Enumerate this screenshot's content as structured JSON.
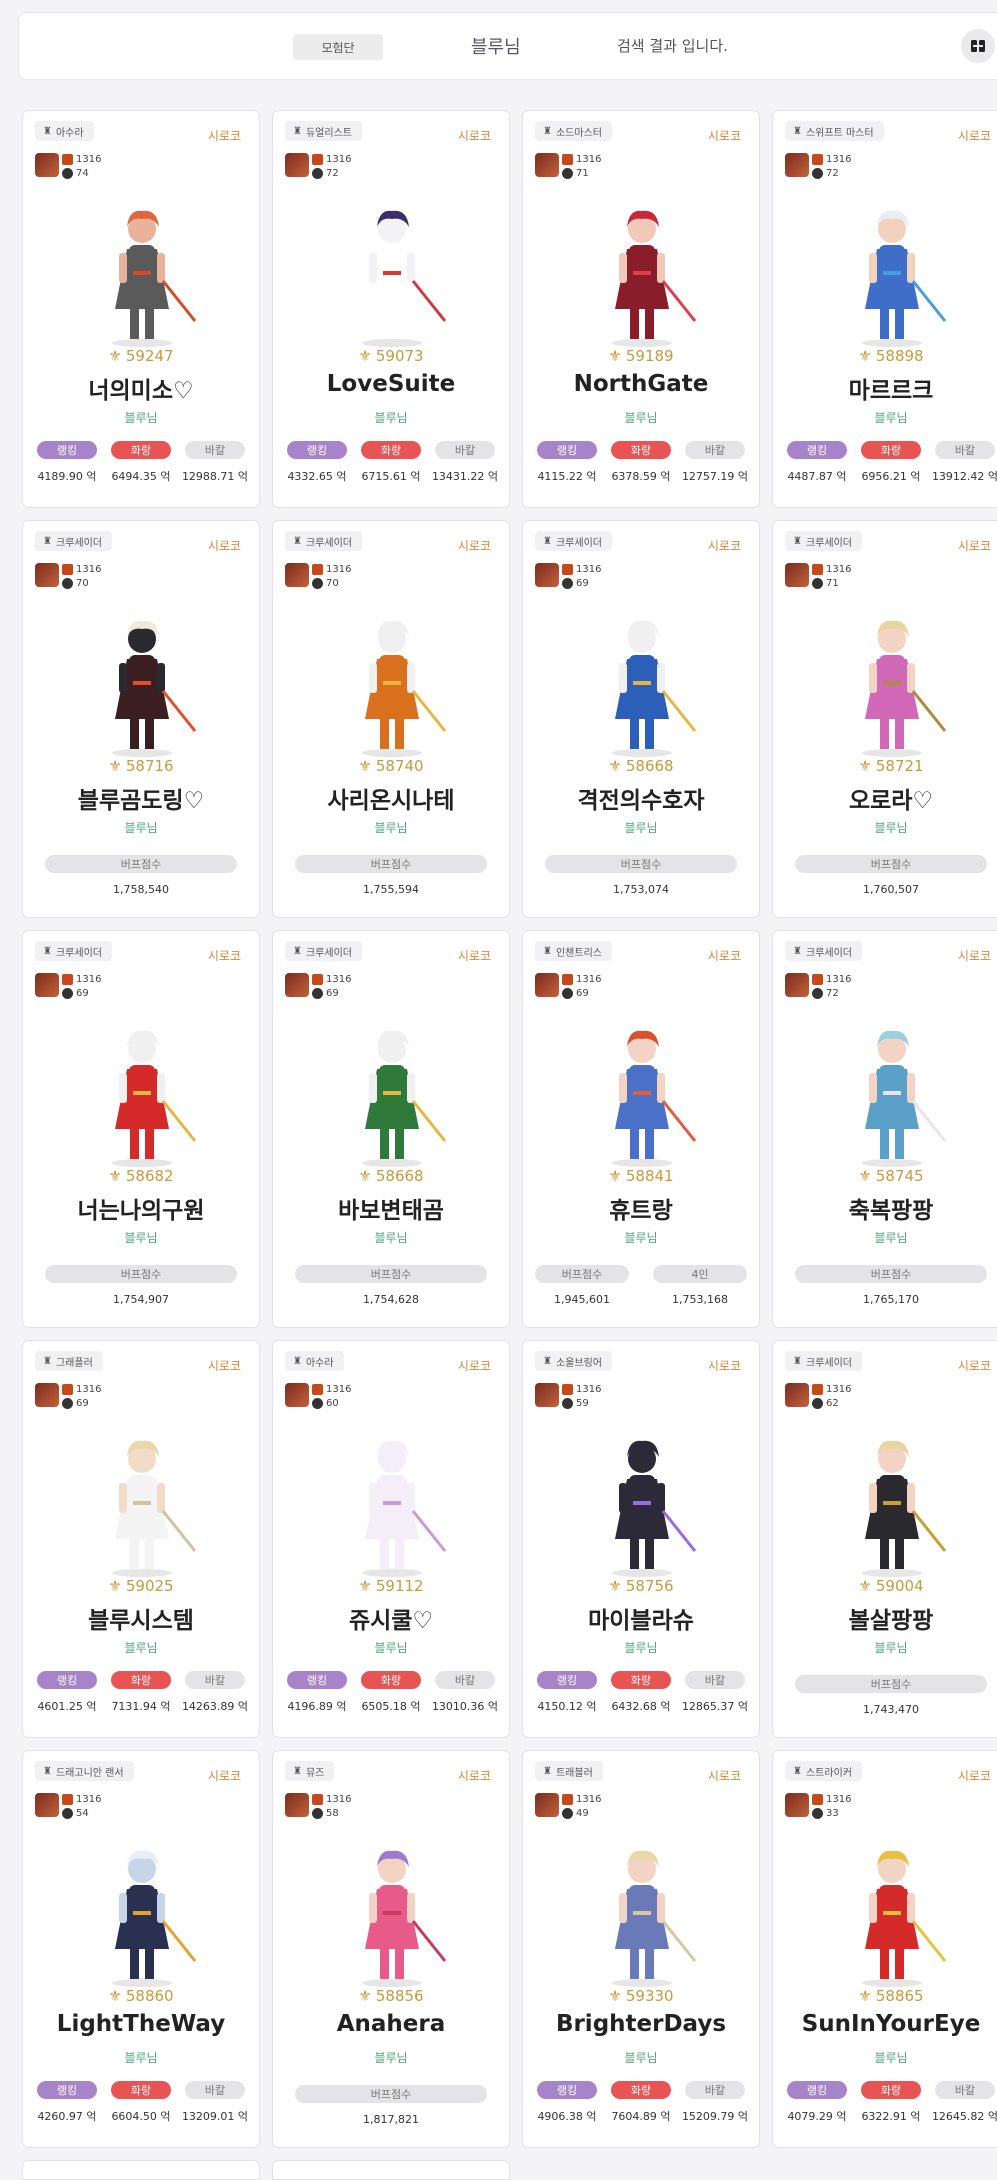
{
  "header": {
    "guild_label": "모험단",
    "adventure_name": "블루님",
    "result_text": "검색 결과 입니다.",
    "toggle_icon": "layout-toggle-icon"
  },
  "cards": [
    {
      "class": "아수라",
      "server": "시로코",
      "level": "1316",
      "level2": "74",
      "fame": "59247",
      "name": "너의미소♡",
      "adventure": "블루님",
      "type": "damage",
      "rank_label": "랭킹",
      "rank": "4189.90 억",
      "fire_label": "화랑",
      "fire": "6494.35 억",
      "bal_label": "바칼",
      "bal": "12988.71 억",
      "art": {
        "skin": "#e8b39a",
        "outfit": "#5a5a5a",
        "accent": "#d64a2a",
        "hair": "#e0673a"
      }
    },
    {
      "class": "듀얼리스트",
      "server": "시로코",
      "level": "1316",
      "level2": "72",
      "fame": "59073",
      "name": "LoveSuite",
      "adventure": "블루님",
      "type": "damage",
      "rank_label": "랭킹",
      "rank": "4332.65 억",
      "fire_label": "화랑",
      "fire": "6715.61 억",
      "bal_label": "바칼",
      "bal": "13431.22 억",
      "art": {
        "skin": "#f3f3f6",
        "outfit": "#ffffff",
        "accent": "#d23a3a",
        "hair": "#3b2f6b"
      }
    },
    {
      "class": "소드마스터",
      "server": "시로코",
      "level": "1316",
      "level2": "71",
      "fame": "59189",
      "name": "NorthGate",
      "adventure": "블루님",
      "type": "damage",
      "rank_label": "랭킹",
      "rank": "4115.22 억",
      "fire_label": "화랑",
      "fire": "6378.59 억",
      "bal_label": "바칼",
      "bal": "12757.19 억",
      "art": {
        "skin": "#f0c9b8",
        "outfit": "#8a1d2a",
        "accent": "#e23d4f",
        "hair": "#c8283a"
      }
    },
    {
      "class": "스위프트 마스터",
      "server": "시로코",
      "level": "1316",
      "level2": "72",
      "fame": "58898",
      "name": "마르르크",
      "adventure": "블루님",
      "type": "damage",
      "rank_label": "랭킹",
      "rank": "4487.87 억",
      "fire_label": "화랑",
      "fire": "6956.21 억",
      "bal_label": "바칼",
      "bal": "13912.42 억",
      "art": {
        "skin": "#f1d2bc",
        "outfit": "#3e6ec8",
        "accent": "#4a9ce0",
        "hair": "#e8eef6"
      }
    },
    {
      "class": "크루세이더",
      "server": "시로코",
      "level": "1316",
      "level2": "70",
      "fame": "58716",
      "name": "블루곰도링♡",
      "adventure": "블루님",
      "type": "buff",
      "buff_label": "버프점수",
      "buff": "1,758,540",
      "art": {
        "skin": "#2a2a2e",
        "outfit": "#3a1e22",
        "accent": "#e0502a",
        "hair": "#f0eadc"
      }
    },
    {
      "class": "크루세이더",
      "server": "시로코",
      "level": "1316",
      "level2": "70",
      "fame": "58740",
      "name": "사리온시나테",
      "adventure": "블루님",
      "type": "buff",
      "buff_label": "버프점수",
      "buff": "1,755,594",
      "art": {
        "skin": "#f0f0f0",
        "outfit": "#d9701e",
        "accent": "#e8b640",
        "hair": "#f0f0f0"
      }
    },
    {
      "class": "크루세이더",
      "server": "시로코",
      "level": "1316",
      "level2": "69",
      "fame": "58668",
      "name": "격전의수호자",
      "adventure": "블루님",
      "type": "buff",
      "buff_label": "버프점수",
      "buff": "1,753,074",
      "art": {
        "skin": "#f0f0f0",
        "outfit": "#2b5fb8",
        "accent": "#e8b640",
        "hair": "#f0f0f0"
      }
    },
    {
      "class": "크루세이더",
      "server": "시로코",
      "level": "1316",
      "level2": "71",
      "fame": "58721",
      "name": "오로라♡",
      "adventure": "블루님",
      "type": "buff",
      "buff_label": "버프점수",
      "buff": "1,760,507",
      "art": {
        "skin": "#f3d4c4",
        "outfit": "#d268b8",
        "accent": "#b08a3a",
        "hair": "#e8d6a0"
      }
    },
    {
      "class": "크루세이더",
      "server": "시로코",
      "level": "1316",
      "level2": "69",
      "fame": "58682",
      "name": "너는나의구원",
      "adventure": "블루님",
      "type": "buff",
      "buff_label": "버프점수",
      "buff": "1,754,907",
      "art": {
        "skin": "#f0f0f0",
        "outfit": "#d42a2a",
        "accent": "#e8b640",
        "hair": "#f0f0f0"
      }
    },
    {
      "class": "크루세이더",
      "server": "시로코",
      "level": "1316",
      "level2": "69",
      "fame": "58668",
      "name": "바보변태곰",
      "adventure": "블루님",
      "type": "buff",
      "buff_label": "버프점수",
      "buff": "1,754,628",
      "art": {
        "skin": "#f0f0f0",
        "outfit": "#2f7a3a",
        "accent": "#e8b640",
        "hair": "#f0f0f0"
      }
    },
    {
      "class": "인챈트리스",
      "server": "시로코",
      "level": "1316",
      "level2": "69",
      "fame": "58841",
      "name": "휴트랑",
      "adventure": "블루님",
      "type": "buff2",
      "buff_label": "버프점수",
      "buff": "1,945,601",
      "buff2_label": "4인",
      "buff2": "1,753,168",
      "art": {
        "skin": "#f3d4c4",
        "outfit": "#4a70c8",
        "accent": "#e85a3a",
        "hair": "#d9502a"
      }
    },
    {
      "class": "크루세이더",
      "server": "시로코",
      "level": "1316",
      "level2": "72",
      "fame": "58745",
      "name": "축복팡팡",
      "adventure": "블루님",
      "type": "buff",
      "buff_label": "버프점수",
      "buff": "1,765,170",
      "art": {
        "skin": "#f3d4c4",
        "outfit": "#5aa0c8",
        "accent": "#f0e0e8",
        "hair": "#9ad0e0"
      }
    },
    {
      "class": "그래플러",
      "server": "시로코",
      "level": "1316",
      "level2": "69",
      "fame": "59025",
      "name": "블루시스템",
      "adventure": "블루님",
      "type": "damage",
      "rank_label": "랭킹",
      "rank": "4601.25 억",
      "fire_label": "화랑",
      "fire": "7131.94 억",
      "bal_label": "바칼",
      "bal": "14263.89 억",
      "art": {
        "skin": "#f1dcc8",
        "outfit": "#f4f4f4",
        "accent": "#cfc3a0",
        "hair": "#e8d8a8"
      }
    },
    {
      "class": "아수라",
      "server": "시로코",
      "level": "1316",
      "level2": "60",
      "fame": "59112",
      "name": "쥬시쿨♡",
      "adventure": "블루님",
      "type": "damage",
      "rank_label": "랭킹",
      "rank": "4196.89 억",
      "fire_label": "화랑",
      "fire": "6505.18 억",
      "bal_label": "바칼",
      "bal": "13010.36 억",
      "art": {
        "skin": "#f4eef8",
        "outfit": "#f4eef8",
        "accent": "#c89ad8",
        "hair": "#f4eef8"
      }
    },
    {
      "class": "소울브링어",
      "server": "시로코",
      "level": "1316",
      "level2": "59",
      "fame": "58756",
      "name": "마이블라슈",
      "adventure": "블루님",
      "type": "damage",
      "rank_label": "랭킹",
      "rank": "4150.12 억",
      "fire_label": "화랑",
      "fire": "6432.68 억",
      "bal_label": "바칼",
      "bal": "12865.37 억",
      "art": {
        "skin": "#2c2a38",
        "outfit": "#2c2a38",
        "accent": "#9a6ae0",
        "hair": "#2c2a38"
      }
    },
    {
      "class": "크루세이더",
      "server": "시로코",
      "level": "1316",
      "level2": "62",
      "fame": "59004",
      "name": "볼살팡팡",
      "adventure": "블루님",
      "type": "buff",
      "buff_label": "버프점수",
      "buff": "1,743,470",
      "art": {
        "skin": "#f3d4c4",
        "outfit": "#2a2a2e",
        "accent": "#c8a030",
        "hair": "#e8d6a0"
      }
    },
    {
      "class": "드래고니안 랜서",
      "server": "시로코",
      "level": "1316",
      "level2": "54",
      "fame": "58860",
      "name": "LightTheWay",
      "adventure": "블루님",
      "type": "damage",
      "rank_label": "랭킹",
      "rank": "4260.97 억",
      "fire_label": "화랑",
      "fire": "6604.50 억",
      "bal_label": "바칼",
      "bal": "13209.01 억",
      "art": {
        "skin": "#c8d4e8",
        "outfit": "#2a3050",
        "accent": "#e8a030",
        "hair": "#e8eef6"
      }
    },
    {
      "class": "뮤즈",
      "server": "시로코",
      "level": "1316",
      "level2": "58",
      "fame": "58856",
      "name": "Anahera",
      "adventure": "블루님",
      "type": "buff",
      "buff_label": "버프점수",
      "buff": "1,817,821",
      "art": {
        "skin": "#f3d4c4",
        "outfit": "#e85a8a",
        "accent": "#c83a5a",
        "hair": "#a07ad0"
      }
    },
    {
      "class": "트래블러",
      "server": "시로코",
      "level": "1316",
      "level2": "49",
      "fame": "59330",
      "name": "BrighterDays",
      "adventure": "블루님",
      "type": "damage",
      "rank_label": "랭킹",
      "rank": "4906.38 억",
      "fire_label": "화랑",
      "fire": "7604.89 억",
      "bal_label": "바칼",
      "bal": "15209.79 억",
      "art": {
        "skin": "#f3d4c4",
        "outfit": "#6a7ab8",
        "accent": "#d8c8a0",
        "hair": "#e8d8a8"
      }
    },
    {
      "class": "스트라이커",
      "server": "시로코",
      "level": "1316",
      "level2": "33",
      "fame": "58865",
      "name": "SunInYourEye",
      "adventure": "블루님",
      "type": "damage",
      "rank_label": "랭킹",
      "rank": "4079.29 억",
      "fire_label": "화랑",
      "fire": "6322.91 억",
      "bal_label": "바칼",
      "bal": "12645.82 억",
      "art": {
        "skin": "#f3d4c4",
        "outfit": "#d42a2a",
        "accent": "#e8c040",
        "hair": "#e8c040"
      }
    }
  ]
}
